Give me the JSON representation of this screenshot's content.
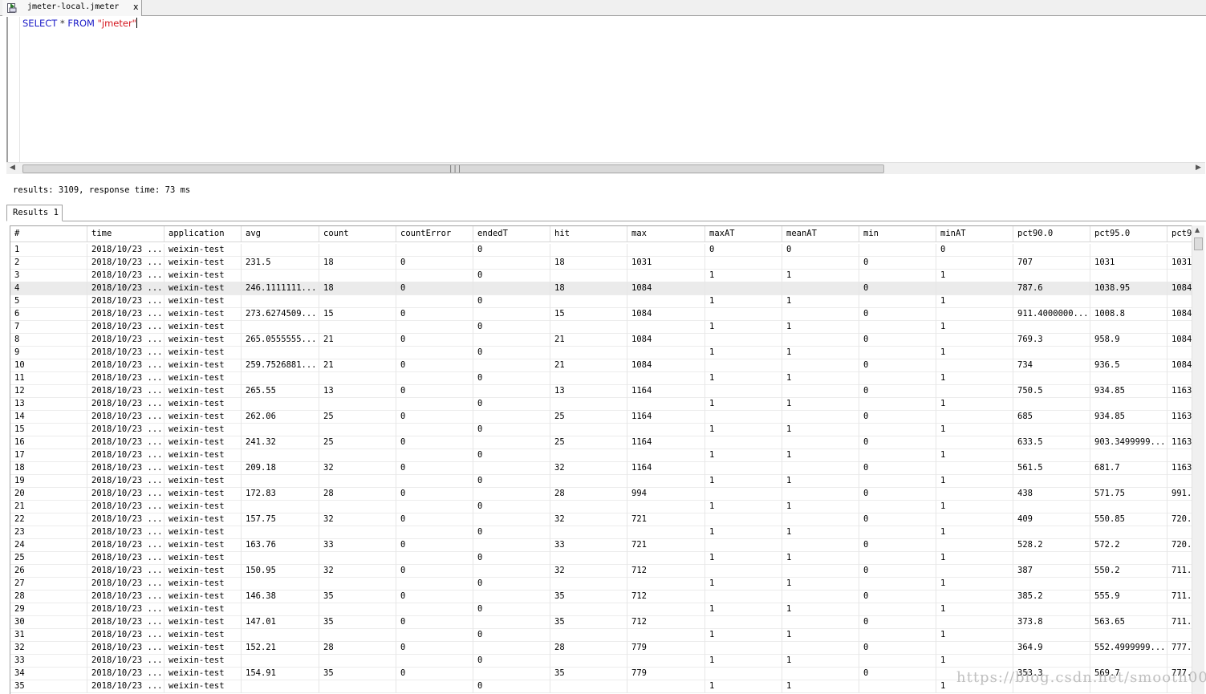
{
  "editor_tab": {
    "label": "jmeter-local.jmeter",
    "close": "x"
  },
  "query": {
    "select": "SELECT",
    "star": "*",
    "from": "FROM",
    "table": "\"jmeter\""
  },
  "status": "results: 3109, response time: 73 ms",
  "results_tab": "Results 1",
  "columns": [
    "#",
    "time",
    "application",
    "avg",
    "count",
    "countError",
    "endedT",
    "hit",
    "max",
    "maxAT",
    "meanAT",
    "min",
    "minAT",
    "pct90.0",
    "pct95.0",
    "pct9"
  ],
  "rows": [
    [
      "1",
      "2018/10/23 ...",
      "weixin-test",
      "",
      "",
      "",
      "0",
      "",
      "",
      "0",
      "0",
      "",
      "0",
      "",
      "",
      ""
    ],
    [
      "2",
      "2018/10/23 ...",
      "weixin-test",
      "231.5",
      "18",
      "0",
      "",
      "18",
      "1031",
      "",
      "",
      "0",
      "",
      "707",
      "1031",
      "1031"
    ],
    [
      "3",
      "2018/10/23 ...",
      "weixin-test",
      "",
      "",
      "",
      "0",
      "",
      "",
      "1",
      "1",
      "",
      "1",
      "",
      "",
      ""
    ],
    [
      "4",
      "2018/10/23 ...",
      "weixin-test",
      "246.1111111...",
      "18",
      "0",
      "",
      "18",
      "1084",
      "",
      "",
      "0",
      "",
      "787.6",
      "1038.95",
      "1084"
    ],
    [
      "5",
      "2018/10/23 ...",
      "weixin-test",
      "",
      "",
      "",
      "0",
      "",
      "",
      "1",
      "1",
      "",
      "1",
      "",
      "",
      ""
    ],
    [
      "6",
      "2018/10/23 ...",
      "weixin-test",
      "273.6274509...",
      "15",
      "0",
      "",
      "15",
      "1084",
      "",
      "",
      "0",
      "",
      "911.4000000...",
      "1008.8",
      "1084"
    ],
    [
      "7",
      "2018/10/23 ...",
      "weixin-test",
      "",
      "",
      "",
      "0",
      "",
      "",
      "1",
      "1",
      "",
      "1",
      "",
      "",
      ""
    ],
    [
      "8",
      "2018/10/23 ...",
      "weixin-test",
      "265.0555555...",
      "21",
      "0",
      "",
      "21",
      "1084",
      "",
      "",
      "0",
      "",
      "769.3",
      "958.9",
      "1084"
    ],
    [
      "9",
      "2018/10/23 ...",
      "weixin-test",
      "",
      "",
      "",
      "0",
      "",
      "",
      "1",
      "1",
      "",
      "1",
      "",
      "",
      ""
    ],
    [
      "10",
      "2018/10/23 ...",
      "weixin-test",
      "259.7526881...",
      "21",
      "0",
      "",
      "21",
      "1084",
      "",
      "",
      "0",
      "",
      "734",
      "936.5",
      "1084"
    ],
    [
      "11",
      "2018/10/23 ...",
      "weixin-test",
      "",
      "",
      "",
      "0",
      "",
      "",
      "1",
      "1",
      "",
      "1",
      "",
      "",
      ""
    ],
    [
      "12",
      "2018/10/23 ...",
      "weixin-test",
      "265.55",
      "13",
      "0",
      "",
      "13",
      "1164",
      "",
      "",
      "0",
      "",
      "750.5",
      "934.85",
      "1163"
    ],
    [
      "13",
      "2018/10/23 ...",
      "weixin-test",
      "",
      "",
      "",
      "0",
      "",
      "",
      "1",
      "1",
      "",
      "1",
      "",
      "",
      ""
    ],
    [
      "14",
      "2018/10/23 ...",
      "weixin-test",
      "262.06",
      "25",
      "0",
      "",
      "25",
      "1164",
      "",
      "",
      "0",
      "",
      "685",
      "934.85",
      "1163"
    ],
    [
      "15",
      "2018/10/23 ...",
      "weixin-test",
      "",
      "",
      "",
      "0",
      "",
      "",
      "1",
      "1",
      "",
      "1",
      "",
      "",
      ""
    ],
    [
      "16",
      "2018/10/23 ...",
      "weixin-test",
      "241.32",
      "25",
      "0",
      "",
      "25",
      "1164",
      "",
      "",
      "0",
      "",
      "633.5",
      "903.3499999...",
      "1163"
    ],
    [
      "17",
      "2018/10/23 ...",
      "weixin-test",
      "",
      "",
      "",
      "0",
      "",
      "",
      "1",
      "1",
      "",
      "1",
      "",
      "",
      ""
    ],
    [
      "18",
      "2018/10/23 ...",
      "weixin-test",
      "209.18",
      "32",
      "0",
      "",
      "32",
      "1164",
      "",
      "",
      "0",
      "",
      "561.5",
      "681.7",
      "1163"
    ],
    [
      "19",
      "2018/10/23 ...",
      "weixin-test",
      "",
      "",
      "",
      "0",
      "",
      "",
      "1",
      "1",
      "",
      "1",
      "",
      "",
      ""
    ],
    [
      "20",
      "2018/10/23 ...",
      "weixin-test",
      "172.83",
      "28",
      "0",
      "",
      "28",
      "994",
      "",
      "",
      "0",
      "",
      "438",
      "571.75",
      "991."
    ],
    [
      "21",
      "2018/10/23 ...",
      "weixin-test",
      "",
      "",
      "",
      "0",
      "",
      "",
      "1",
      "1",
      "",
      "1",
      "",
      "",
      ""
    ],
    [
      "22",
      "2018/10/23 ...",
      "weixin-test",
      "157.75",
      "32",
      "0",
      "",
      "32",
      "721",
      "",
      "",
      "0",
      "",
      "409",
      "550.85",
      "720."
    ],
    [
      "23",
      "2018/10/23 ...",
      "weixin-test",
      "",
      "",
      "",
      "0",
      "",
      "",
      "1",
      "1",
      "",
      "1",
      "",
      "",
      ""
    ],
    [
      "24",
      "2018/10/23 ...",
      "weixin-test",
      "163.76",
      "33",
      "0",
      "",
      "33",
      "721",
      "",
      "",
      "0",
      "",
      "528.2",
      "572.2",
      "720."
    ],
    [
      "25",
      "2018/10/23 ...",
      "weixin-test",
      "",
      "",
      "",
      "0",
      "",
      "",
      "1",
      "1",
      "",
      "1",
      "",
      "",
      ""
    ],
    [
      "26",
      "2018/10/23 ...",
      "weixin-test",
      "150.95",
      "32",
      "0",
      "",
      "32",
      "712",
      "",
      "",
      "0",
      "",
      "387",
      "550.2",
      "711."
    ],
    [
      "27",
      "2018/10/23 ...",
      "weixin-test",
      "",
      "",
      "",
      "0",
      "",
      "",
      "1",
      "1",
      "",
      "1",
      "",
      "",
      ""
    ],
    [
      "28",
      "2018/10/23 ...",
      "weixin-test",
      "146.38",
      "35",
      "0",
      "",
      "35",
      "712",
      "",
      "",
      "0",
      "",
      "385.2",
      "555.9",
      "711."
    ],
    [
      "29",
      "2018/10/23 ...",
      "weixin-test",
      "",
      "",
      "",
      "0",
      "",
      "",
      "1",
      "1",
      "",
      "1",
      "",
      "",
      ""
    ],
    [
      "30",
      "2018/10/23 ...",
      "weixin-test",
      "147.01",
      "35",
      "0",
      "",
      "35",
      "712",
      "",
      "",
      "0",
      "",
      "373.8",
      "563.65",
      "711."
    ],
    [
      "31",
      "2018/10/23 ...",
      "weixin-test",
      "",
      "",
      "",
      "0",
      "",
      "",
      "1",
      "1",
      "",
      "1",
      "",
      "",
      ""
    ],
    [
      "32",
      "2018/10/23 ...",
      "weixin-test",
      "152.21",
      "28",
      "0",
      "",
      "28",
      "779",
      "",
      "",
      "0",
      "",
      "364.9",
      "552.4999999...",
      "777."
    ],
    [
      "33",
      "2018/10/23 ...",
      "weixin-test",
      "",
      "",
      "",
      "0",
      "",
      "",
      "1",
      "1",
      "",
      "1",
      "",
      "",
      ""
    ],
    [
      "34",
      "2018/10/23 ...",
      "weixin-test",
      "154.91",
      "35",
      "0",
      "",
      "35",
      "779",
      "",
      "",
      "0",
      "",
      "353.3",
      "569.7",
      "777."
    ],
    [
      "35",
      "2018/10/23 ...",
      "weixin-test",
      "",
      "",
      "",
      "0",
      "",
      "",
      "1",
      "1",
      "",
      "1",
      "",
      "",
      ""
    ]
  ],
  "selected_row": 3,
  "watermark": "https://blog.csdn.net/smooth00",
  "colors": {
    "keyword": "#1c1cc8",
    "string": "#d4141c",
    "selected_row": "#ebebeb"
  }
}
